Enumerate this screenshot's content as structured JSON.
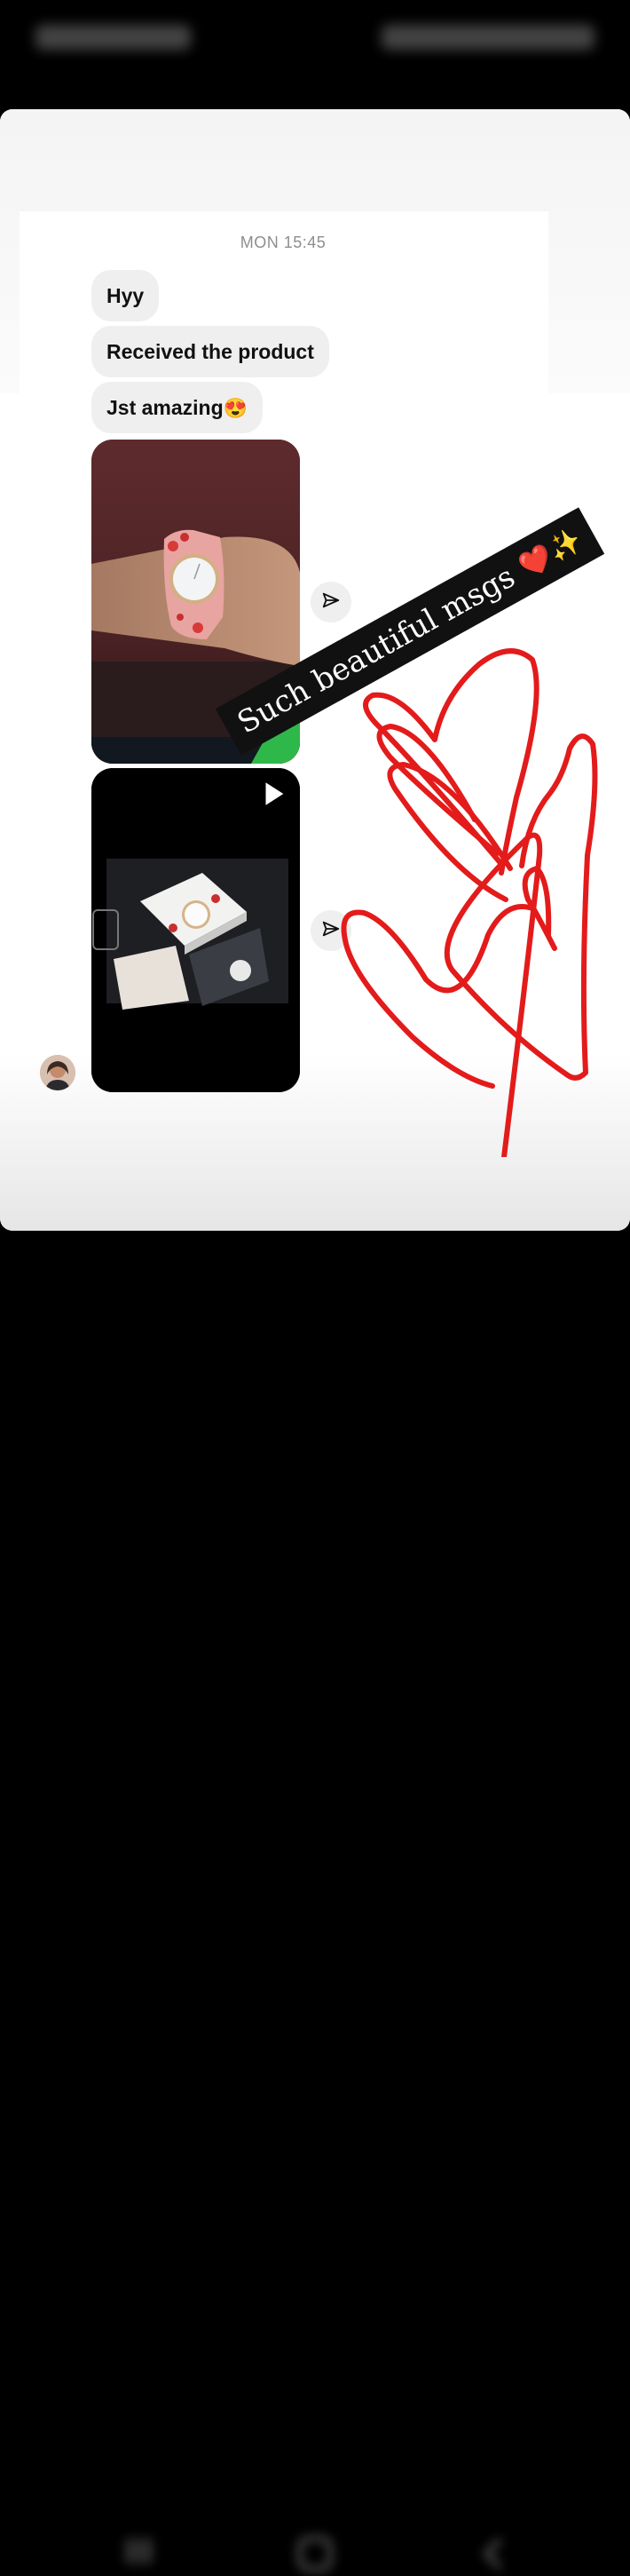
{
  "chat": {
    "timestamp": "MON 15:45",
    "messages": [
      {
        "text": "Hyy"
      },
      {
        "text": "Received the product"
      },
      {
        "text": "Jst amazing",
        "emoji": "😍"
      }
    ]
  },
  "sticker": {
    "text": "Such beautiful msgs",
    "emoji": "❤️✨"
  },
  "icons": {
    "share": "paper-plane-icon",
    "play": "play-icon",
    "avatar": "profile-avatar"
  },
  "colors": {
    "scribble": "#e31b1b",
    "bubble": "#efefef",
    "sticker_bg": "#111111"
  }
}
